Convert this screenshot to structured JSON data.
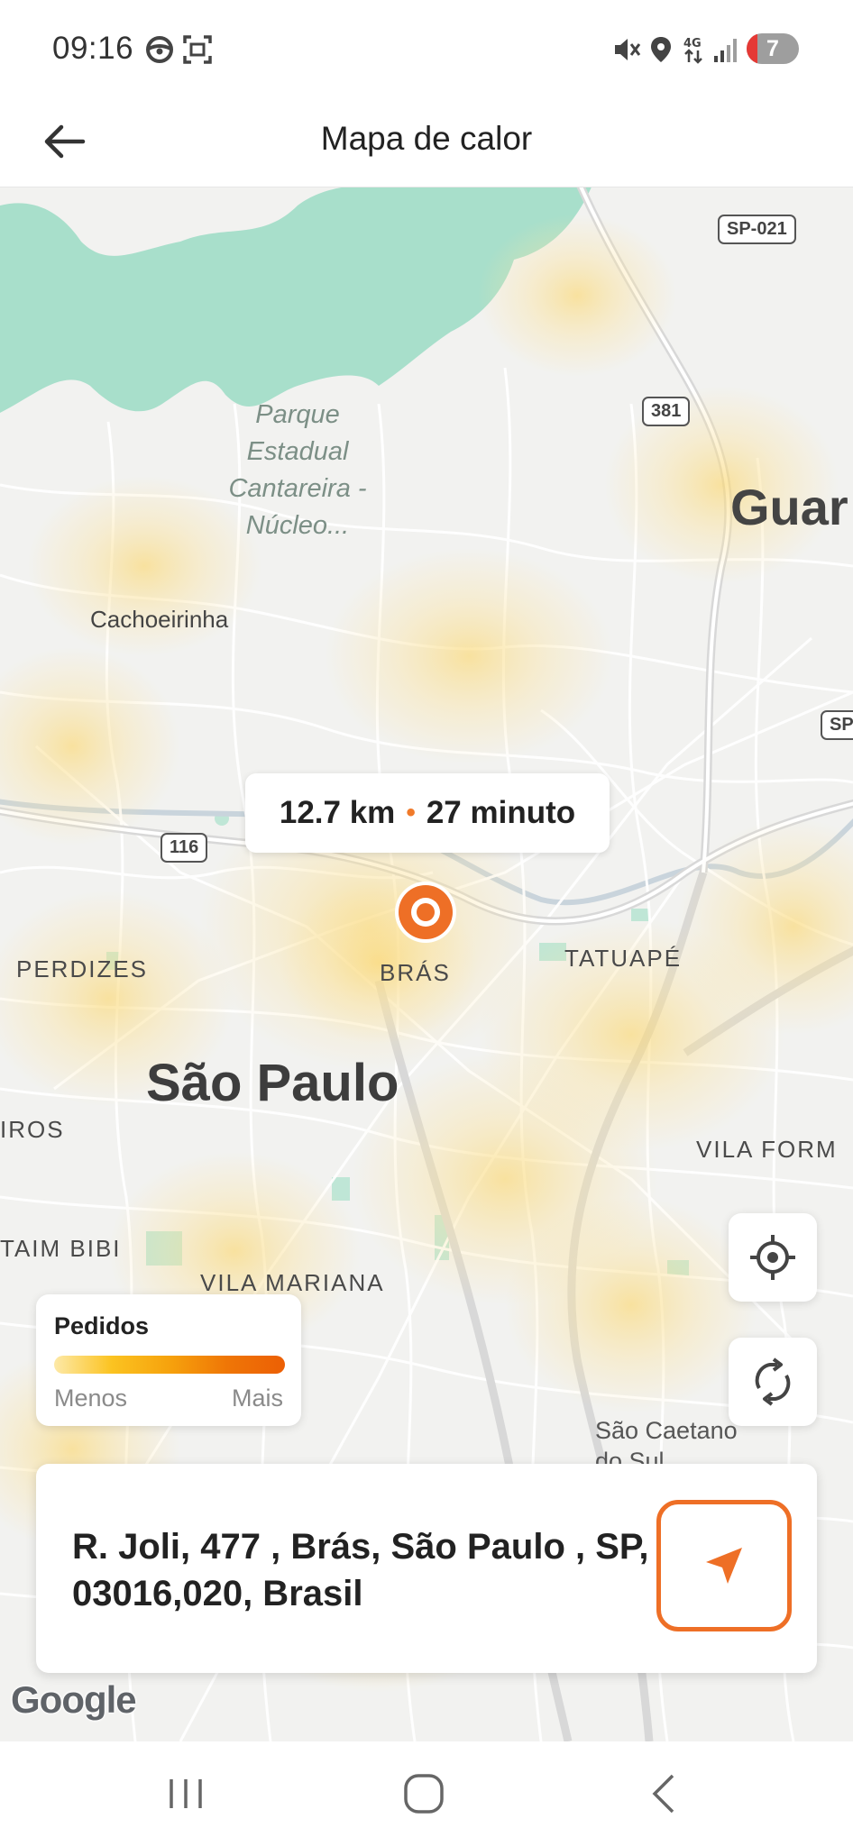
{
  "status_bar": {
    "time": "09:16",
    "left_icons": [
      "steering-wheel-icon",
      "screenshot-icon"
    ],
    "right_icons": [
      "mute-icon",
      "location-icon",
      "4g-icon",
      "signal-icon"
    ],
    "battery_label": "7"
  },
  "header": {
    "title": "Mapa de calor",
    "back_icon": "arrow-left-icon"
  },
  "map": {
    "labels": {
      "park": "Parque Estadual Cantareira - Núcleo...",
      "cachoeirinha": "Cachoeirinha",
      "guar": "Guar",
      "perdizes": "PERDIZES",
      "bras": "BRÁS",
      "tatuape": "TATUAPÉ",
      "sao_paulo": "São Paulo",
      "iros": "IROS",
      "vila_form": "VILA FORM",
      "taim_bibi": "TAIM BIBI",
      "vila_mariana": "VILA MARIANA",
      "sao_caetano": "São Caetano do Sul"
    },
    "road_badges": {
      "sp021": "SP-021",
      "r381": "381",
      "r116": "116",
      "sp": "SP"
    },
    "route": {
      "distance": "12.7 km",
      "separator": "•",
      "duration": "27 minuto"
    },
    "attribution": "Google"
  },
  "legend": {
    "title": "Pedidos",
    "low": "Menos",
    "high": "Mais",
    "gradient_colors": [
      "#fde9a8",
      "#fbc321",
      "#f6a20d",
      "#ef7606",
      "#ec5f05"
    ]
  },
  "controls": {
    "locate_icon": "crosshair-icon",
    "refresh_icon": "refresh-icon"
  },
  "address_card": {
    "address": "R. Joli, 477 , Brás, São Paulo , SP, 03016,020, Brasil",
    "navigate_icon": "navigation-arrow-icon"
  },
  "system_nav": {
    "recents_icon": "recents-icon",
    "home_icon": "home-icon",
    "back_icon": "system-back-icon"
  },
  "colors": {
    "accent": "#ee6f26",
    "park_green": "#a8dfcb",
    "map_background": "#f2f2f0",
    "heat": "#fbd873"
  }
}
